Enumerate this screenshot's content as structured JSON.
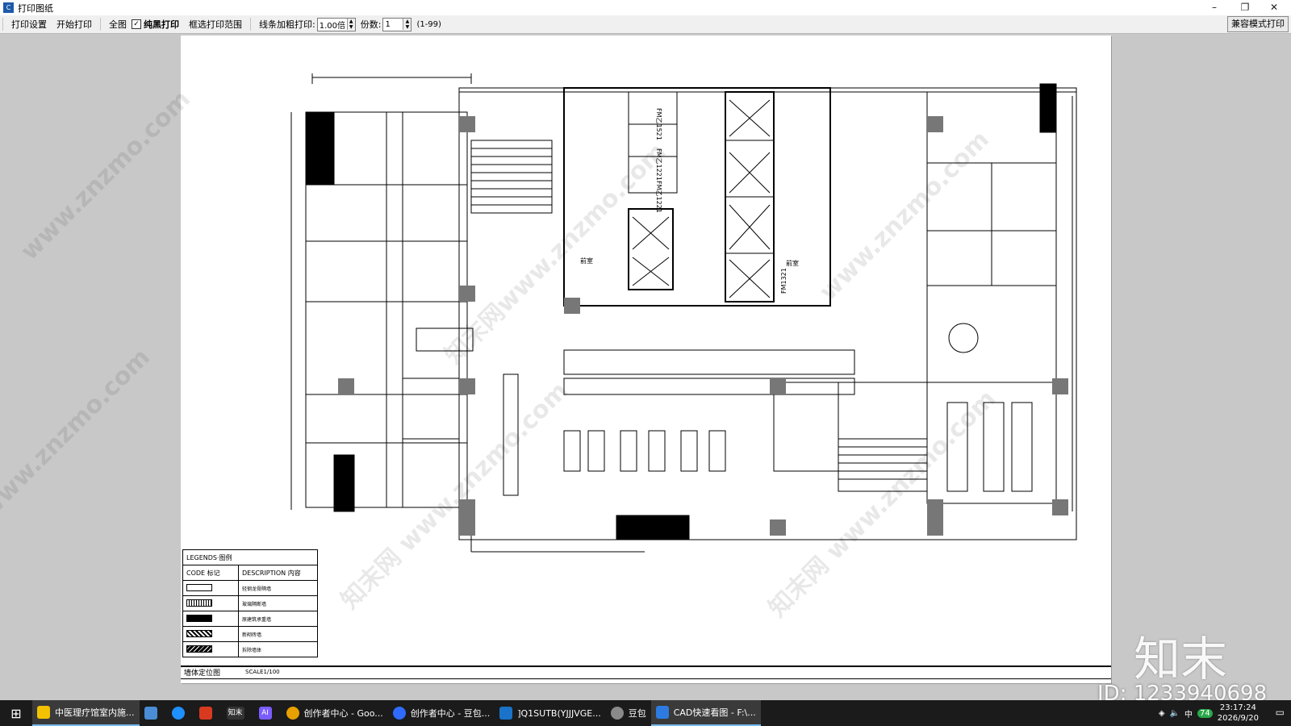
{
  "window": {
    "title": "打印图纸"
  },
  "toolbar": {
    "print_settings": "打印设置",
    "start_print": "开始打印",
    "full_view": "全图",
    "pure_black_checked": true,
    "pure_black": "纯黑打印",
    "select_range": "框选打印范围",
    "line_bold_label": "线条加粗打印:",
    "line_bold_value": "1.00倍",
    "copies_label": "份数:",
    "copies_value": "1",
    "copies_range": "(1-99)",
    "compat_print": "兼容模式打印"
  },
  "legend": {
    "title": "LEGENDS·图例",
    "code_header": "CODE 标记",
    "desc_header": "DESCRIPTION 内容",
    "rows": [
      {
        "swatch": "sw1",
        "desc": "轻钢龙骨隔墙"
      },
      {
        "swatch": "sw2",
        "desc": "玻璃隔断墙"
      },
      {
        "swatch": "sw3",
        "desc": "原建筑承重墙"
      },
      {
        "swatch": "sw4",
        "desc": "新砌砖墙"
      },
      {
        "swatch": "sw5",
        "desc": "拆除墙体"
      }
    ]
  },
  "drawing": {
    "name": "墙体定位图",
    "scale": "SCALE1/100"
  },
  "plan_labels": [
    "FM乙1521",
    "FM乙1221",
    "FM乙1221",
    "FM1321",
    "前室",
    "前室"
  ],
  "watermarks": [
    "www.znzmo.com",
    "知末网www.znzmo.com",
    "知末网 www.znzmo.com"
  ],
  "brand": "知末",
  "image_id": "ID: 1233940698",
  "taskbar": {
    "items": [
      {
        "label": "中医理疗馆室内施...",
        "color": "#f2c200"
      },
      {
        "label": "",
        "color": "#4a8cd6"
      },
      {
        "label": "",
        "color": "#1e90ff"
      },
      {
        "label": "",
        "color": "#d83a20"
      },
      {
        "label": "知末",
        "color": "#333"
      },
      {
        "label": "AI",
        "color": "#7b5cff"
      },
      {
        "label": "创作者中心 - Goo...",
        "color": "#e8a000"
      },
      {
        "label": "创作者中心 - 豆包...",
        "color": "#2f6bff"
      },
      {
        "label": "]Q1SUTB(YJJJVGE...",
        "color": "#1a73c9"
      },
      {
        "label": "豆包",
        "color": "#8a8a8a"
      },
      {
        "label": "CAD快速看图 - F:\\...",
        "color": "#2d7be0"
      }
    ],
    "ime": "中",
    "badge": "74",
    "time": "23:17:24",
    "date": "2026/9/20"
  }
}
